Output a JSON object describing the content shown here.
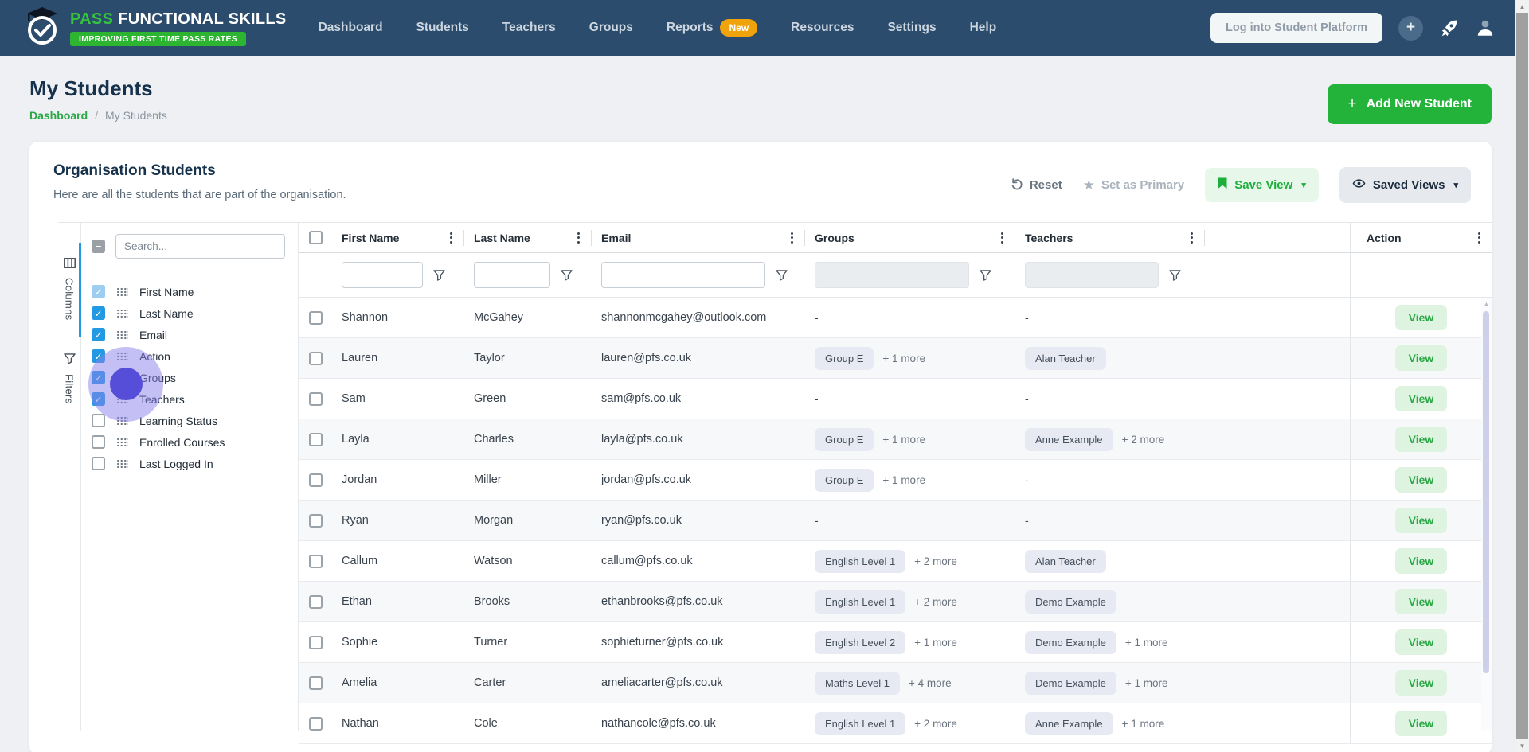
{
  "nav": {
    "brand": {
      "name_green": "PASS",
      "name_white": "FUNCTIONAL SKILLS",
      "tagline": "IMPROVING FIRST TIME PASS RATES"
    },
    "items": [
      {
        "label": "Dashboard"
      },
      {
        "label": "Students"
      },
      {
        "label": "Teachers"
      },
      {
        "label": "Groups"
      },
      {
        "label": "Reports",
        "badge": "New"
      },
      {
        "label": "Resources"
      },
      {
        "label": "Settings"
      },
      {
        "label": "Help"
      }
    ],
    "login_button": "Log into Student Platform",
    "icons": [
      "plus-circle-icon",
      "rocket-icon",
      "user-icon"
    ]
  },
  "page": {
    "title": "My Students",
    "breadcrumb_home": "Dashboard",
    "breadcrumb_separator": "/",
    "breadcrumb_current": "My Students",
    "add_button": "Add New Student"
  },
  "card": {
    "title": "Organisation Students",
    "subtitle": "Here are all the students that are part of the organisation.",
    "actions": {
      "reset": "Reset",
      "set_primary": "Set as Primary",
      "save_view": "Save View",
      "saved_views": "Saved Views"
    }
  },
  "panel": {
    "tabs": [
      {
        "label": "Columns",
        "active": true
      },
      {
        "label": "Filters",
        "active": false
      }
    ],
    "search_placeholder": "Search...",
    "columns": [
      {
        "label": "First Name",
        "checked": true,
        "muted": true
      },
      {
        "label": "Last Name",
        "checked": true
      },
      {
        "label": "Email",
        "checked": true
      },
      {
        "label": "Action",
        "checked": true
      },
      {
        "label": "Groups",
        "checked": true
      },
      {
        "label": "Teachers",
        "checked": true
      },
      {
        "label": "Learning Status",
        "checked": false
      },
      {
        "label": "Enrolled Courses",
        "checked": false
      },
      {
        "label": "Last Logged In",
        "checked": false
      }
    ]
  },
  "table": {
    "headers": [
      "First Name",
      "Last Name",
      "Email",
      "Groups",
      "Teachers",
      "Action"
    ],
    "empty_value": "-",
    "view_label": "View",
    "rows": [
      {
        "first": "Shannon",
        "last": "McGahey",
        "email": "shannonmcgahey@outlook.com",
        "group_chip": null,
        "group_more": null,
        "teacher_chip": null,
        "teacher_more": null
      },
      {
        "first": "Lauren",
        "last": "Taylor",
        "email": "lauren@pfs.co.uk",
        "group_chip": "Group E",
        "group_more": "+ 1 more",
        "teacher_chip": "Alan Teacher",
        "teacher_more": null
      },
      {
        "first": "Sam",
        "last": "Green",
        "email": "sam@pfs.co.uk",
        "group_chip": null,
        "group_more": null,
        "teacher_chip": null,
        "teacher_more": null
      },
      {
        "first": "Layla",
        "last": "Charles",
        "email": "layla@pfs.co.uk",
        "group_chip": "Group E",
        "group_more": "+ 1 more",
        "teacher_chip": "Anne Example",
        "teacher_more": "+ 2 more"
      },
      {
        "first": "Jordan",
        "last": "Miller",
        "email": "jordan@pfs.co.uk",
        "group_chip": "Group E",
        "group_more": "+ 1 more",
        "teacher_chip": null,
        "teacher_more": null
      },
      {
        "first": "Ryan",
        "last": "Morgan",
        "email": "ryan@pfs.co.uk",
        "group_chip": null,
        "group_more": null,
        "teacher_chip": null,
        "teacher_more": null
      },
      {
        "first": "Callum",
        "last": "Watson",
        "email": "callum@pfs.co.uk",
        "group_chip": "English Level 1",
        "group_more": "+ 2 more",
        "teacher_chip": "Alan Teacher",
        "teacher_more": null
      },
      {
        "first": "Ethan",
        "last": "Brooks",
        "email": "ethanbrooks@pfs.co.uk",
        "group_chip": "English Level 1",
        "group_more": "+ 2 more",
        "teacher_chip": "Demo Example",
        "teacher_more": null
      },
      {
        "first": "Sophie",
        "last": "Turner",
        "email": "sophieturner@pfs.co.uk",
        "group_chip": "English Level 2",
        "group_more": "+ 1 more",
        "teacher_chip": "Demo Example",
        "teacher_more": "+ 1 more"
      },
      {
        "first": "Amelia",
        "last": "Carter",
        "email": "ameliacarter@pfs.co.uk",
        "group_chip": "Maths Level 1",
        "group_more": "+ 4 more",
        "teacher_chip": "Demo Example",
        "teacher_more": "+ 1 more"
      },
      {
        "first": "Nathan",
        "last": "Cole",
        "email": "nathancole@pfs.co.uk",
        "group_chip": "English Level 1",
        "group_more": "+ 2 more",
        "teacher_chip": "Anne Example",
        "teacher_more": "+ 1 more"
      }
    ]
  },
  "colors": {
    "navbar": "#2b4c6c",
    "brand_green": "#2db531",
    "accent_green": "#23b33a",
    "checkbox_blue": "#2499e3",
    "badge_orange": "#f0a30a",
    "click_indicator_purple": "#564dd8"
  }
}
